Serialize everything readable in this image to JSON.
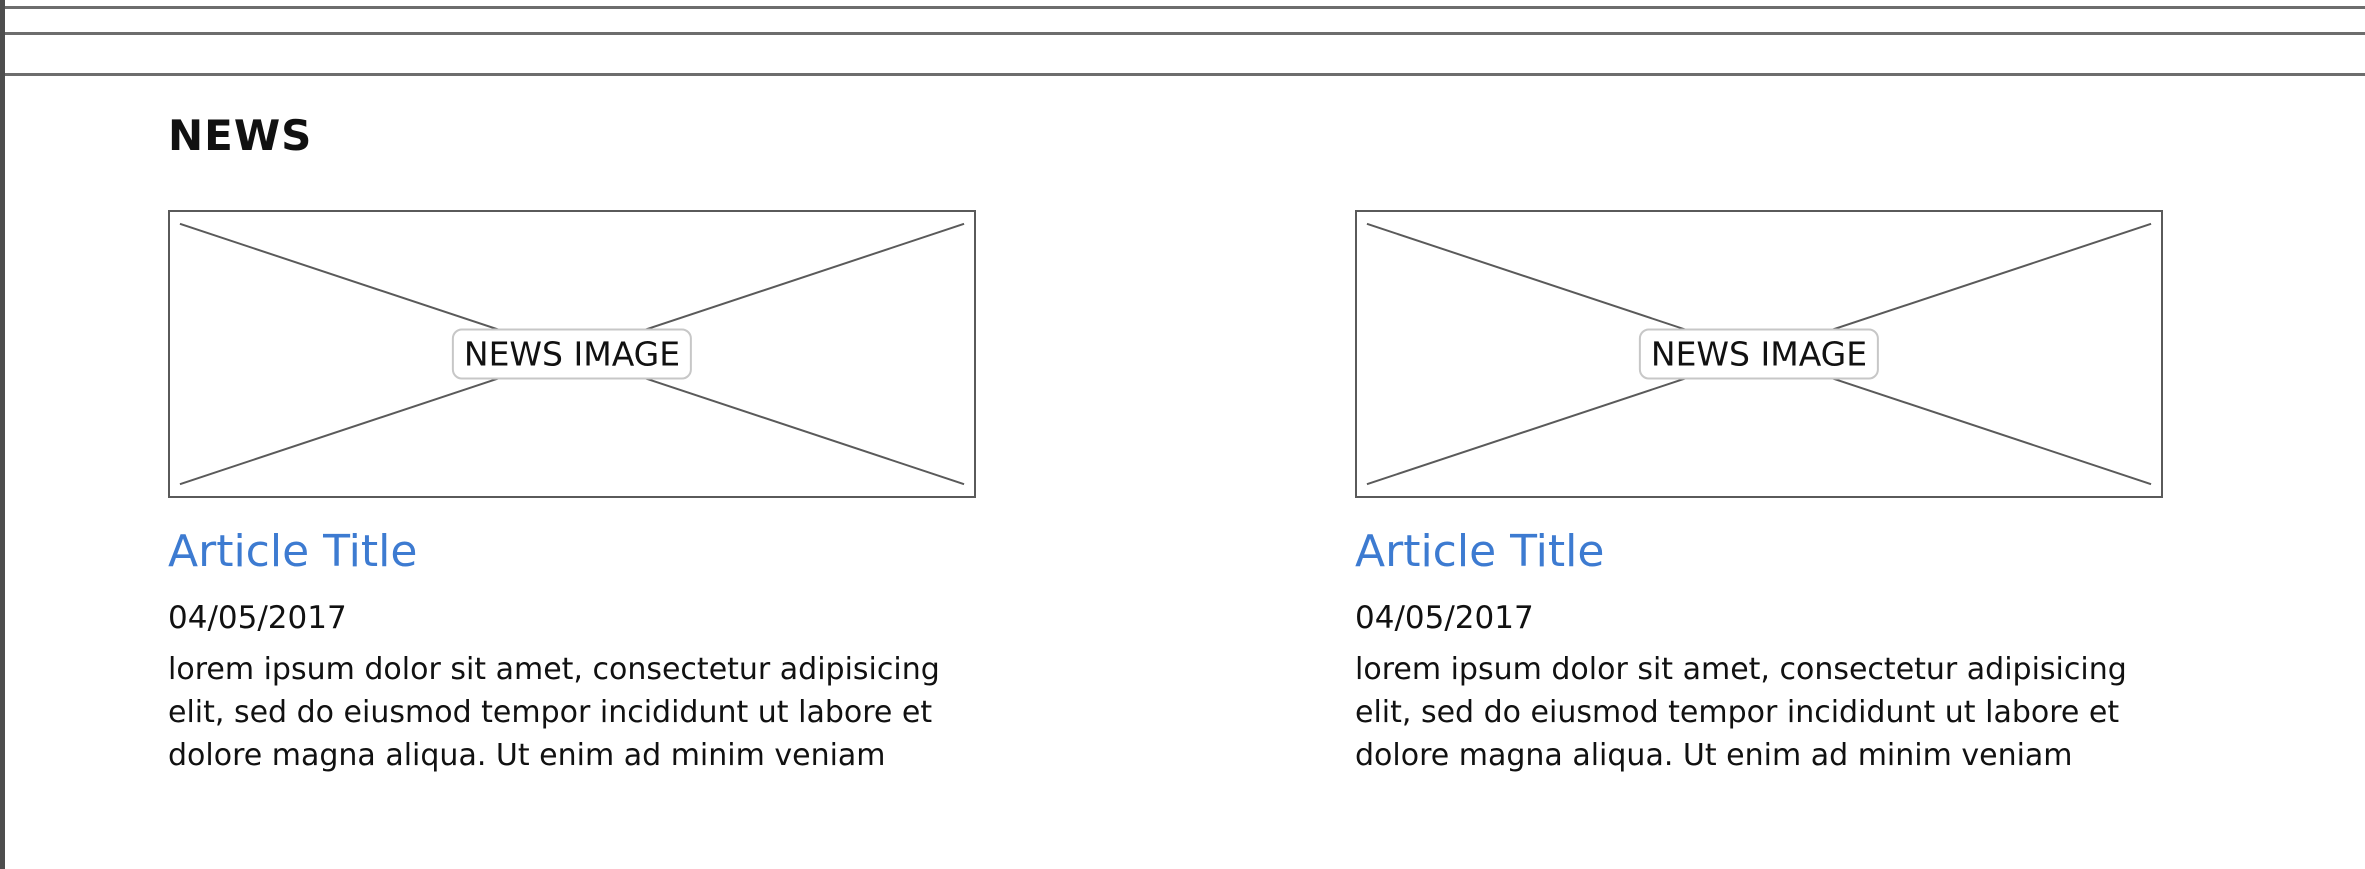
{
  "news": {
    "heading": "NEWS",
    "articles": [
      {
        "image_label": "NEWS IMAGE",
        "title": "Article Title",
        "date": "04/05/2017",
        "body": "lorem ipsum dolor sit amet, consectetur adipisicing elit, sed do eiusmod tempor incididunt ut labore et dolore magna aliqua. Ut enim ad minim veniam"
      },
      {
        "image_label": "NEWS IMAGE",
        "title": "Article Title",
        "date": "04/05/2017",
        "body": "lorem ipsum dolor sit amet, consectetur adipisicing elit, sed do eiusmod tempor incididunt ut labore et dolore magna aliqua. Ut enim ad minim veniam"
      }
    ]
  },
  "colors": {
    "link": "#3d7bd1",
    "wireframe_line": "#5a5a5a"
  }
}
